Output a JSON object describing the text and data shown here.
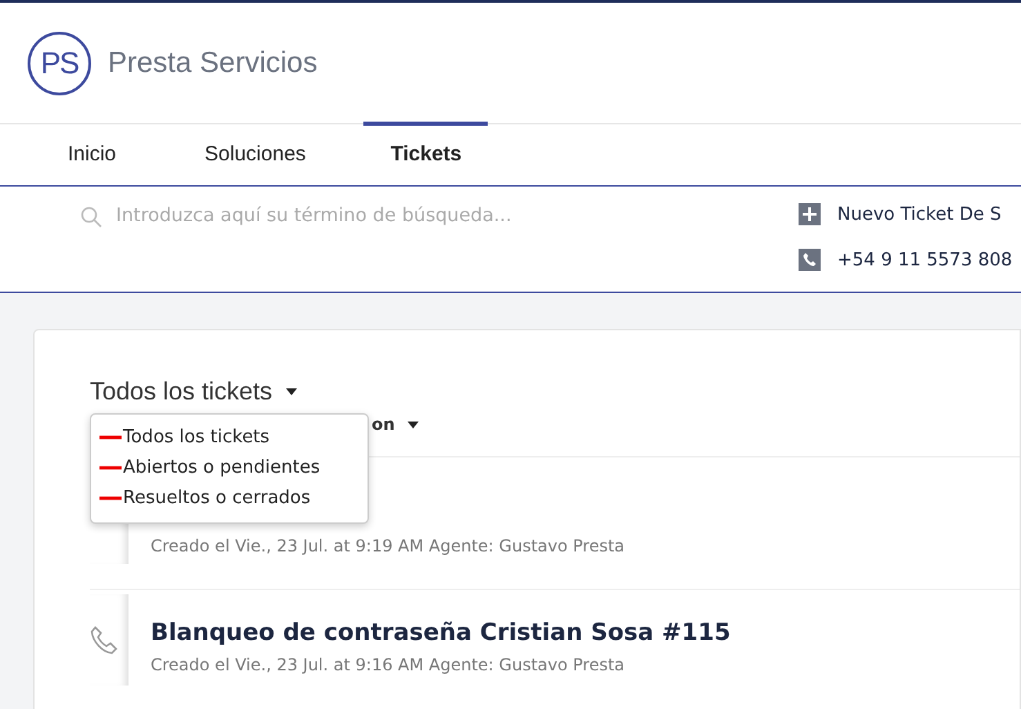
{
  "brand": {
    "logo": "PS",
    "name": "Presta Servicios"
  },
  "tabs": [
    {
      "label": "Inicio",
      "selected": false
    },
    {
      "label": "Soluciones",
      "selected": false
    },
    {
      "label": "Tickets",
      "selected": true
    }
  ],
  "search": {
    "placeholder": "Introduzca aquí su término de búsqueda..."
  },
  "actions": [
    {
      "kind": "new",
      "label": "Nuevo Ticket De S"
    },
    {
      "kind": "phone",
      "label": "+54 9 11 5573 808"
    }
  ],
  "filter": {
    "label": "Todos los tickets",
    "options": [
      {
        "label": "Todos los tickets"
      },
      {
        "label": "Abiertos o pendientes"
      },
      {
        "label": "Resueltos o cerrados"
      }
    ]
  },
  "sort": {
    "label": "on"
  },
  "tickets": [
    {
      "meta": "Creado el Vie., 23 Jul. at 9:19 AM Agente: Gustavo Presta"
    },
    {
      "title": "Blanqueo de contraseña Cristian Sosa #115",
      "meta": "Creado el Vie., 23 Jul. at 9:16 AM Agente: Gustavo Presta"
    }
  ]
}
